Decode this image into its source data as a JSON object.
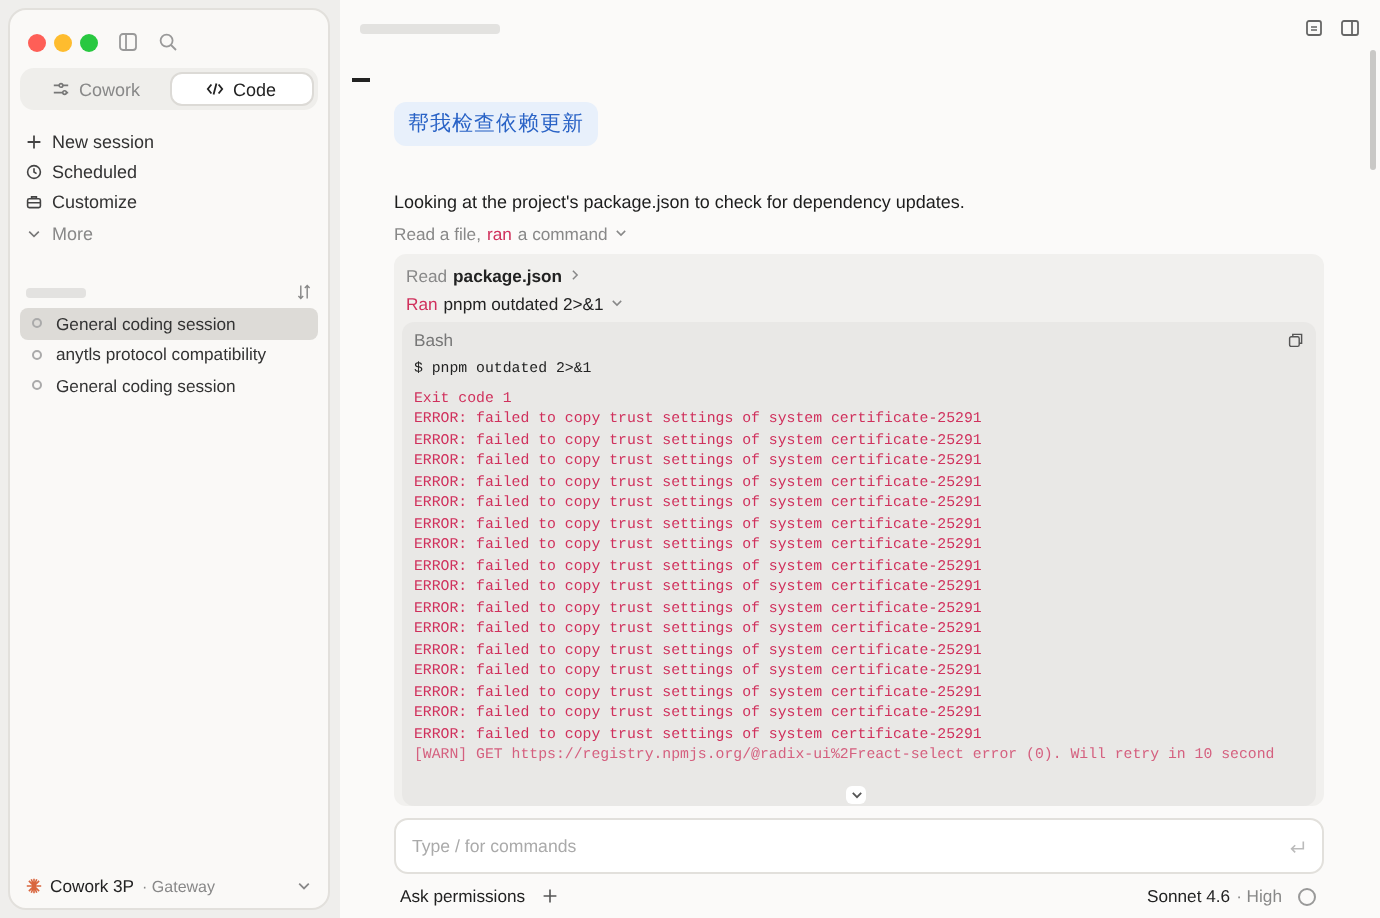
{
  "sidebar": {
    "tabs": [
      {
        "label": "Cowork",
        "selected": false,
        "kind": "cowork"
      },
      {
        "label": "Code",
        "selected": true,
        "kind": "code"
      }
    ],
    "menu": [
      {
        "label": "New session",
        "kind": "plus"
      },
      {
        "label": "Scheduled",
        "kind": "clock"
      },
      {
        "label": "Customize",
        "kind": "case"
      },
      {
        "label": "More",
        "kind": "more"
      }
    ],
    "sessions": [
      {
        "title": "General coding session",
        "selected": true
      },
      {
        "title": "anytls protocol compatibility",
        "selected": false
      },
      {
        "title": "General coding session",
        "selected": false
      }
    ],
    "footer": {
      "name": "Cowork 3P",
      "detail": "· Gateway"
    }
  },
  "chat": {
    "user_message": "帮我检查依赖更新",
    "assistant_text": "Looking at the project's package.json to check for dependency updates.",
    "summary": [
      {
        "text": "Read a file,",
        "kind": "plain"
      },
      {
        "text": "ran",
        "kind": "accent"
      },
      {
        "text": "a command",
        "kind": "plain"
      }
    ],
    "steps": [
      {
        "verb": "Read",
        "target": "package.json",
        "kind": "read",
        "expanded": false
      },
      {
        "verb": "Ran",
        "target": "pnpm outdated 2>&1",
        "kind": "run",
        "expanded": true
      }
    ],
    "terminal": {
      "title": "Bash",
      "command": "$ pnpm outdated 2>&1",
      "output": [
        {
          "text": "Exit code 1",
          "kind": "error"
        },
        {
          "text": "ERROR: failed to copy trust settings of system certificate-25291",
          "kind": "error"
        },
        {
          "text": "ERROR: failed to copy trust settings of system certificate-25291",
          "kind": "error"
        },
        {
          "text": "ERROR: failed to copy trust settings of system certificate-25291",
          "kind": "error"
        },
        {
          "text": "ERROR: failed to copy trust settings of system certificate-25291",
          "kind": "error"
        },
        {
          "text": "ERROR: failed to copy trust settings of system certificate-25291",
          "kind": "error"
        },
        {
          "text": "ERROR: failed to copy trust settings of system certificate-25291",
          "kind": "error"
        },
        {
          "text": "ERROR: failed to copy trust settings of system certificate-25291",
          "kind": "error"
        },
        {
          "text": "ERROR: failed to copy trust settings of system certificate-25291",
          "kind": "error"
        },
        {
          "text": "ERROR: failed to copy trust settings of system certificate-25291",
          "kind": "error"
        },
        {
          "text": "ERROR: failed to copy trust settings of system certificate-25291",
          "kind": "error"
        },
        {
          "text": "ERROR: failed to copy trust settings of system certificate-25291",
          "kind": "error"
        },
        {
          "text": "ERROR: failed to copy trust settings of system certificate-25291",
          "kind": "error"
        },
        {
          "text": "ERROR: failed to copy trust settings of system certificate-25291",
          "kind": "error"
        },
        {
          "text": "ERROR: failed to copy trust settings of system certificate-25291",
          "kind": "error"
        },
        {
          "text": "ERROR: failed to copy trust settings of system certificate-25291",
          "kind": "error"
        },
        {
          "text": "ERROR: failed to copy trust settings of system certificate-25291",
          "kind": "error"
        },
        {
          "text": "[WARN] GET https://registry.npmjs.org/@radix-ui%2Freact-select error (0). Will retry in 10 second",
          "kind": "warn"
        }
      ]
    }
  },
  "composer": {
    "placeholder": "Type / for commands",
    "permission_mode": "Ask permissions",
    "model": "Sonnet 4.6",
    "effort": "· High"
  }
}
